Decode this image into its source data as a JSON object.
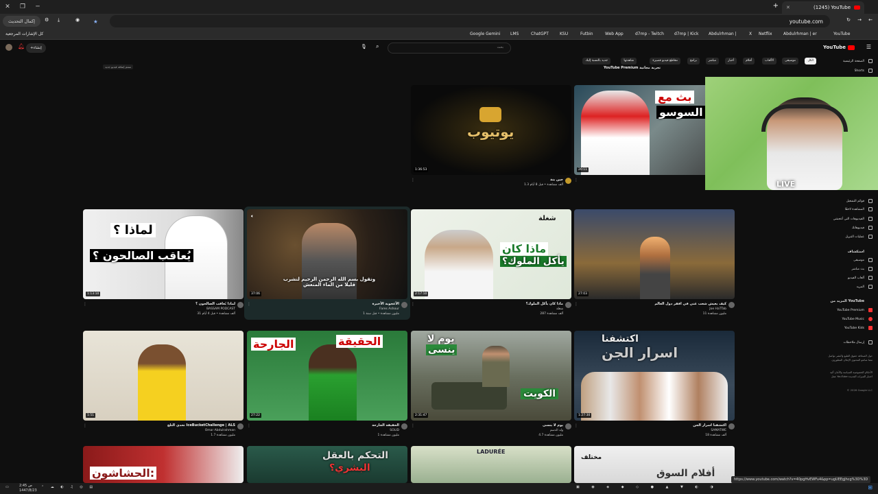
{
  "browser": {
    "tab_title": "(1245) YouTube",
    "url": "youtube.com",
    "update_button": "إكمال التحديث",
    "status_url": "https://www.youtube.com/watch?v=40pgHvEWFu4&pp=ugUEEgJhcg%3D%3D"
  },
  "bookmarks": {
    "all_bookmarks": "كل الإشارات المرجعية",
    "items": [
      "Google Gemini",
      "LMS",
      "ChatGPT",
      "KSU",
      "Futbin",
      "Web App",
      "d7mp - Twitch",
      "d7mp | Kick",
      "Abdulrhman |",
      "X",
      "Netflix",
      "Abdulrhman | er",
      "YouTube"
    ]
  },
  "header": {
    "logo": "YouTube",
    "create": "إنشاء",
    "search_placeholder": "بحث"
  },
  "chips": [
    "الكل",
    "موسيقى",
    "الألعاب",
    "أفلام",
    "أخبار",
    "مباشر",
    "برامج",
    "مقاطع فيديو قصيرة",
    "شاهدتها",
    "جديد بالنسبة إليك",
    "أفلام فيديو",
    "صيحات الطهي",
    "شاهدتها مؤخرًا"
  ],
  "sidebar": {
    "home": "الصفحة الرئيسية",
    "shorts": "Shorts",
    "section_you": "أنت",
    "you_items": [
      "أكثر الفيديوهات",
      "السجل",
      "قوائم التشغيل",
      "المشاهدة لاحقًا",
      "الفيديوهات التي أعجبتني",
      "فيديوهاتك",
      "عمليات التنزيل"
    ],
    "section_explore": "استكشاف",
    "explore_items": [
      "موسيقى",
      "بث مباشر",
      "ألعاب الفيديو",
      "الرياضة",
      "المزيد"
    ],
    "section_more": "المزيد من YouTube",
    "more_items": [
      "YouTube Premium",
      "YouTube Music",
      "YouTube Kids"
    ],
    "report": "إرسال ملاحظات",
    "footer_a": "حول الصحافة حقوق الطبع والنشر تواصل معنا صانعو المحتوى الإعلان المطورون",
    "footer_b": "الأحكام الخصوصية السياسة والأمان آلية عمل YouTube اختبار الميزات الجديدة",
    "copyright": "© 2026 Google LLC"
  },
  "premium_banner": "YouTube Premium تجربة مجانية",
  "sticker": "ستتم إضافة فيديو جديد",
  "videos": [
    {
      "title": "يوتيوب",
      "channel": "",
      "stats": "",
      "duration": "1:36:53"
    },
    {
      "title": "بث مع السوسو",
      "channel": "",
      "stats": "",
      "duration": "20:11"
    },
    {
      "title": "لماذا يُعاقب الصالحون ؟",
      "channel": "BASSAM PODCAST",
      "stats": "31 ألف مشاهدة • قبل 4 أيام",
      "duration": "1:13:10",
      "overlay": "لماذا يُعاقب الصالحون ؟"
    },
    {
      "title": "الأعجوبة الأخيرة",
      "channel": "Fares Ashour",
      "stats": "1 مليون مشاهدة • قبل سنة",
      "duration": "37:06",
      "overlay": "وتقول بسم الله الرحمن الرحيم لتشرب قليلا من الماء المنعش"
    },
    {
      "title": "ماذا كان يأكل الملوك؟",
      "channel": "شغلة",
      "stats": "287 ألف مشاهدة",
      "duration": "2:17:10",
      "overlay": "ماذا كان يأكل الملوك؟"
    },
    {
      "title": "كيف يعيش شعب غني في افقر دول العالم",
      "channel": "Joe HaTTab",
      "stats": "11 مليون مشاهدة",
      "duration": "27:03",
      "overlay": ""
    },
    {
      "title": "تحدي الثلج IceBucketChallenge | ALS",
      "channel": "Omar Abdulrahman",
      "stats": "1.7 مليون مشاهدة",
      "duration": "1:51",
      "overlay": ""
    },
    {
      "title": "الحقيقة الجارحة",
      "channel": "SOLID",
      "stats": "1 مليون مشاهدة",
      "duration": "27:22",
      "overlay": "الحقيقة الجارحة"
    },
    {
      "title": "يوم لا ينسى",
      "channel": "ولد الدسم",
      "stats": "4.7 مليون مشاهدة",
      "duration": "2:31:47",
      "overlay": "يوم لا ينسى"
    },
    {
      "title": "اكتشفنا اسرار الجن",
      "channel": "SAMATWE",
      "stats": "18 ألف مشاهدة",
      "duration": "1:27:30",
      "overlay": "اكتشفنا اسرار الجن"
    },
    {
      "title": "الحشاشون",
      "channel": "",
      "stats": "",
      "duration": "",
      "overlay": "الحشاشون:"
    },
    {
      "title": "التحكم بالعقل البشري",
      "channel": "",
      "stats": "",
      "duration": "",
      "overlay": "التحكم بالعقل البشري"
    },
    {
      "title": "LADUREE",
      "channel": "",
      "stats": "",
      "duration": "",
      "overlay": "LADURÉE"
    },
    {
      "title": "أفلام السوق",
      "channel": "",
      "stats": "",
      "duration": "",
      "overlay": "مختلف"
    }
  ],
  "webcam": {
    "live": "LIVE"
  },
  "taskbar": {
    "time": "2:45 ص",
    "date": "1447/8/23"
  }
}
